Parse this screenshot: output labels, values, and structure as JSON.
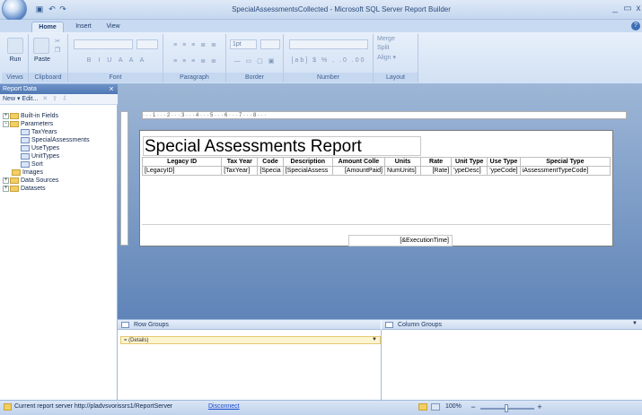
{
  "window": {
    "title": "SpecialAssessmentsCollected - Microsoft SQL Server Report Builder",
    "minimize": "_",
    "restore": "▭",
    "close": "x"
  },
  "ribbon": {
    "tabs": [
      {
        "label": "Home",
        "active": true
      },
      {
        "label": "Insert",
        "active": false
      },
      {
        "label": "View",
        "active": false
      }
    ],
    "groups": {
      "views": "Views",
      "clipboard": "Clipboard",
      "font": "Font",
      "paragraph": "Paragraph",
      "border": "Border",
      "number": "Number",
      "layout": "Layout"
    },
    "buttons": {
      "run": "Run",
      "paste": "Paste",
      "border_width": "1pt",
      "merge": "Merge",
      "split": "Split",
      "align": "Align ▾"
    }
  },
  "report_data": {
    "header": "Report Data",
    "toolbar": "New ▾  Edit...",
    "tree": [
      {
        "label": "Built-in Fields",
        "kind": "folder",
        "expander": "+",
        "level": 0
      },
      {
        "label": "Parameters",
        "kind": "folder",
        "expander": "−",
        "level": 0
      },
      {
        "label": "TaxYears",
        "kind": "param",
        "expander": "",
        "level": 1
      },
      {
        "label": "SpecialAssessments",
        "kind": "param",
        "expander": "",
        "level": 1
      },
      {
        "label": "UseTypes",
        "kind": "param",
        "expander": "",
        "level": 1
      },
      {
        "label": "UnitTypes",
        "kind": "param",
        "expander": "",
        "level": 1
      },
      {
        "label": "Sort",
        "kind": "param",
        "expander": "",
        "level": 1
      },
      {
        "label": "Images",
        "kind": "folder",
        "expander": "",
        "level": 0
      },
      {
        "label": "Data Sources",
        "kind": "folder",
        "expander": "+",
        "level": 0
      },
      {
        "label": "Datasets",
        "kind": "folder",
        "expander": "+",
        "level": 0
      }
    ]
  },
  "ruler": {
    "marks": "· · · 1 · · · 2 · · · 3 · · · 4 · · · 5 · · · 6 · · · 7 · · · 8 · · ·"
  },
  "report": {
    "title": "Special Assessments Report",
    "columns": [
      "Legacy ID",
      "Tax Year",
      "Code",
      "Description",
      "Amount Colle",
      "Units",
      "Rate",
      "Unit Type",
      "Use Type",
      "Special Type"
    ],
    "row": [
      "[LegacyID]",
      "[TaxYear]",
      "[Specia",
      "[SpecialAssess",
      "[AmountPaid]",
      "NumUnits]",
      "[Rate]",
      "'ypeDesc]",
      "'ypeCode]",
      "iAssessmentTypeCode]"
    ],
    "footer_field": "[&ExecutionTime]"
  },
  "groups_pane": {
    "row_groups": "Row Groups",
    "column_groups": "Column Groups",
    "details": "= (Details)"
  },
  "status": {
    "server_text": "Current report server http://pladvsvorissrs1/ReportServer",
    "disconnect": "Disconnect",
    "zoom": "100%",
    "zoom_minus": "−",
    "zoom_plus": "+"
  }
}
